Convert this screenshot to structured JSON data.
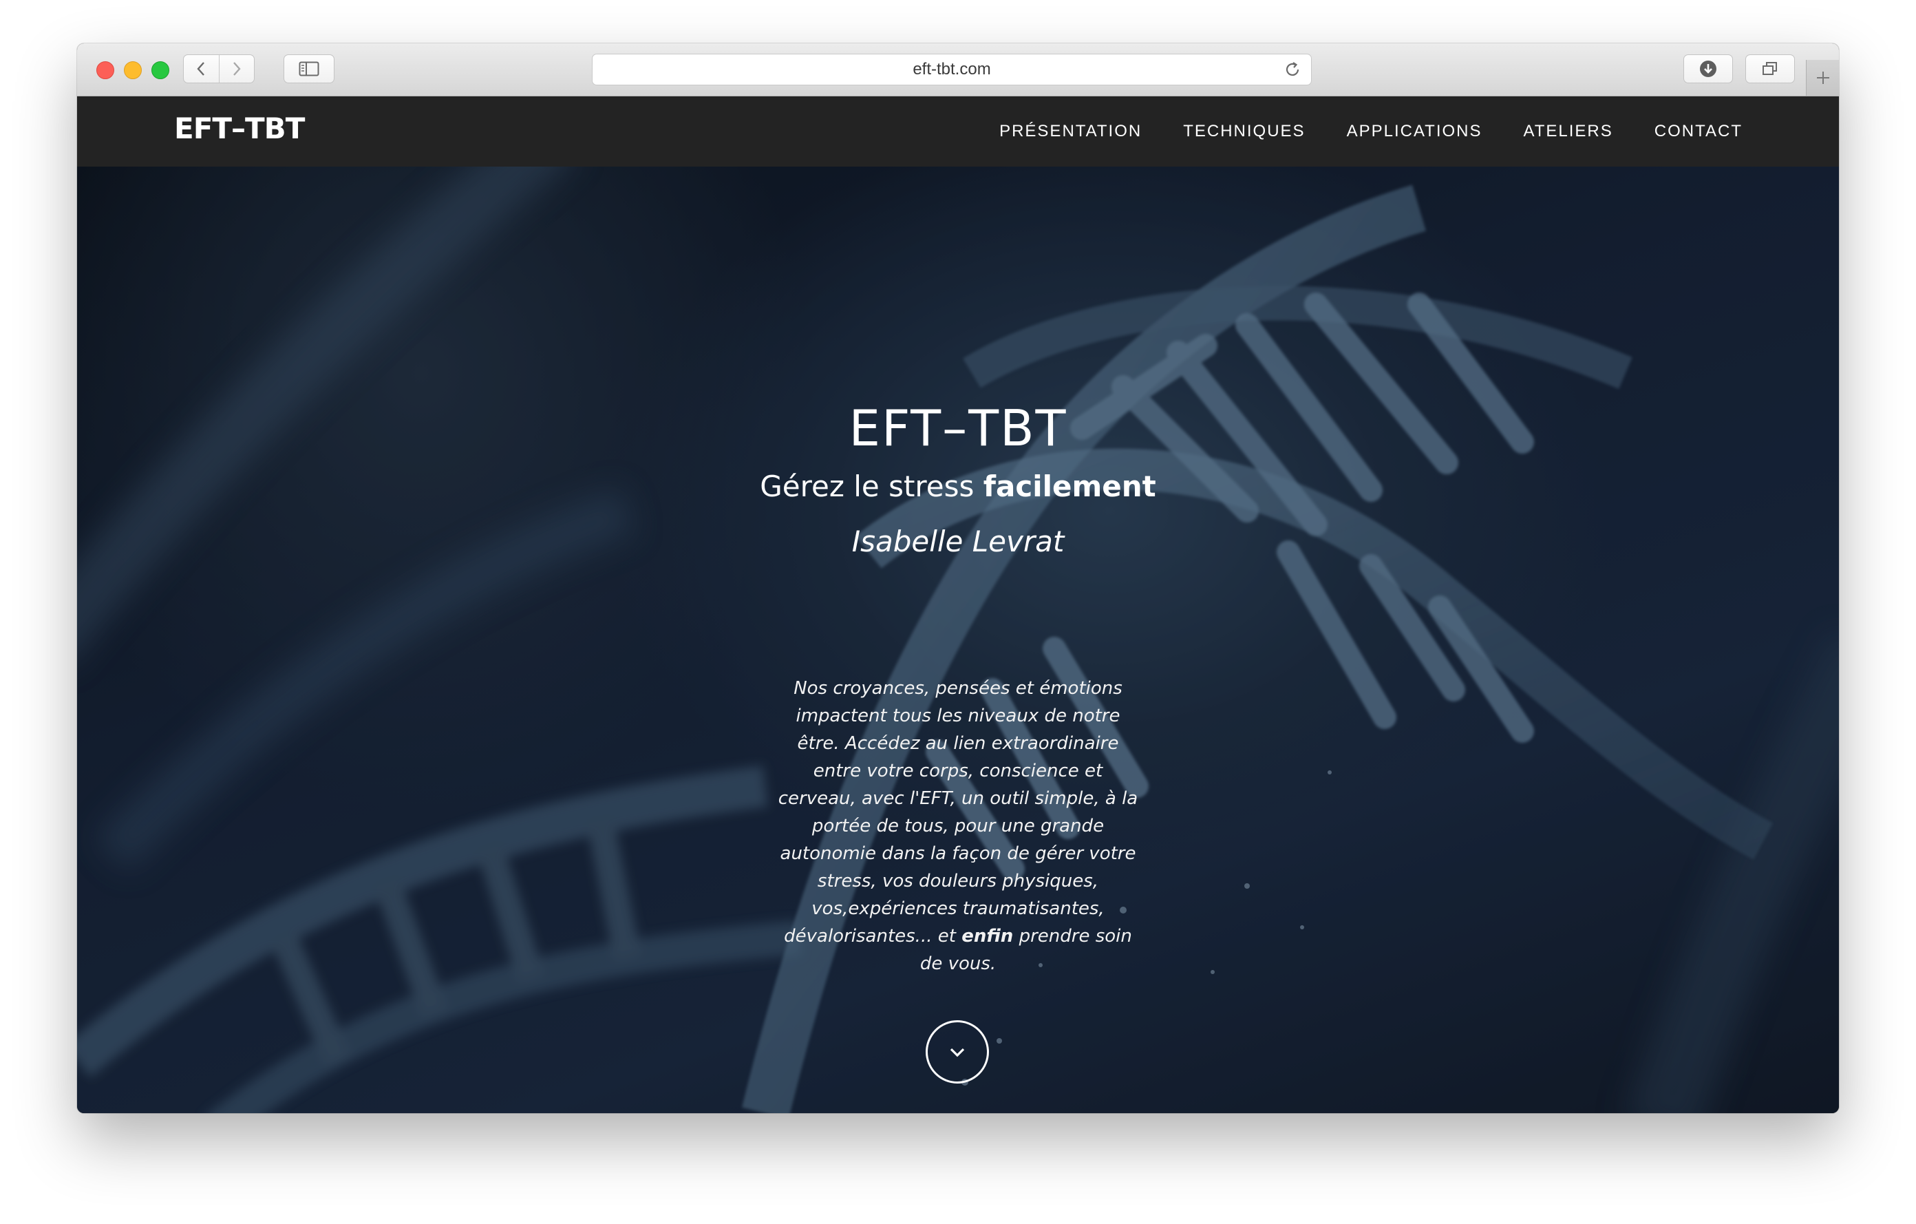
{
  "browser": {
    "url": "eft-tbt.com",
    "icons": {
      "back": "chevron-left-icon",
      "forward": "chevron-right-icon",
      "sidebar": "sidebar-icon",
      "reload": "reload-icon",
      "downloads": "download-icon",
      "tabs": "tabs-overview-icon",
      "new_tab": "plus-icon"
    }
  },
  "site": {
    "brand": "EFT–TBT",
    "nav": [
      {
        "label": "PRÉSENTATION"
      },
      {
        "label": "TECHNIQUES"
      },
      {
        "label": "APPLICATIONS"
      },
      {
        "label": "ATELIERS"
      },
      {
        "label": "CONTACT"
      }
    ]
  },
  "hero": {
    "title": "EFT–TBT",
    "subtitle_prefix": "Gérez le stress ",
    "subtitle_bold": "facilement",
    "author": "Isabelle Levrat",
    "text_prefix": "Nos croyances, pensées et émotions impactent tous les niveaux de notre être. Accédez au lien extraordinaire entre votre corps, conscience et cerveau, avec l'EFT, un outil simple, à la portée de tous, pour une grande autonomie dans la façon de gérer votre stress, vos douleurs physiques, vos,expériences traumatisantes, dévalorisantes... et ",
    "text_bold": "enfin",
    "text_suffix": " prendre soin de vous.",
    "scroll_icon": "chevron-down-icon"
  },
  "colors": {
    "navbar_bg": "#232323",
    "hero_bg": "#1b2c44",
    "dna": "#5d7f9b"
  }
}
